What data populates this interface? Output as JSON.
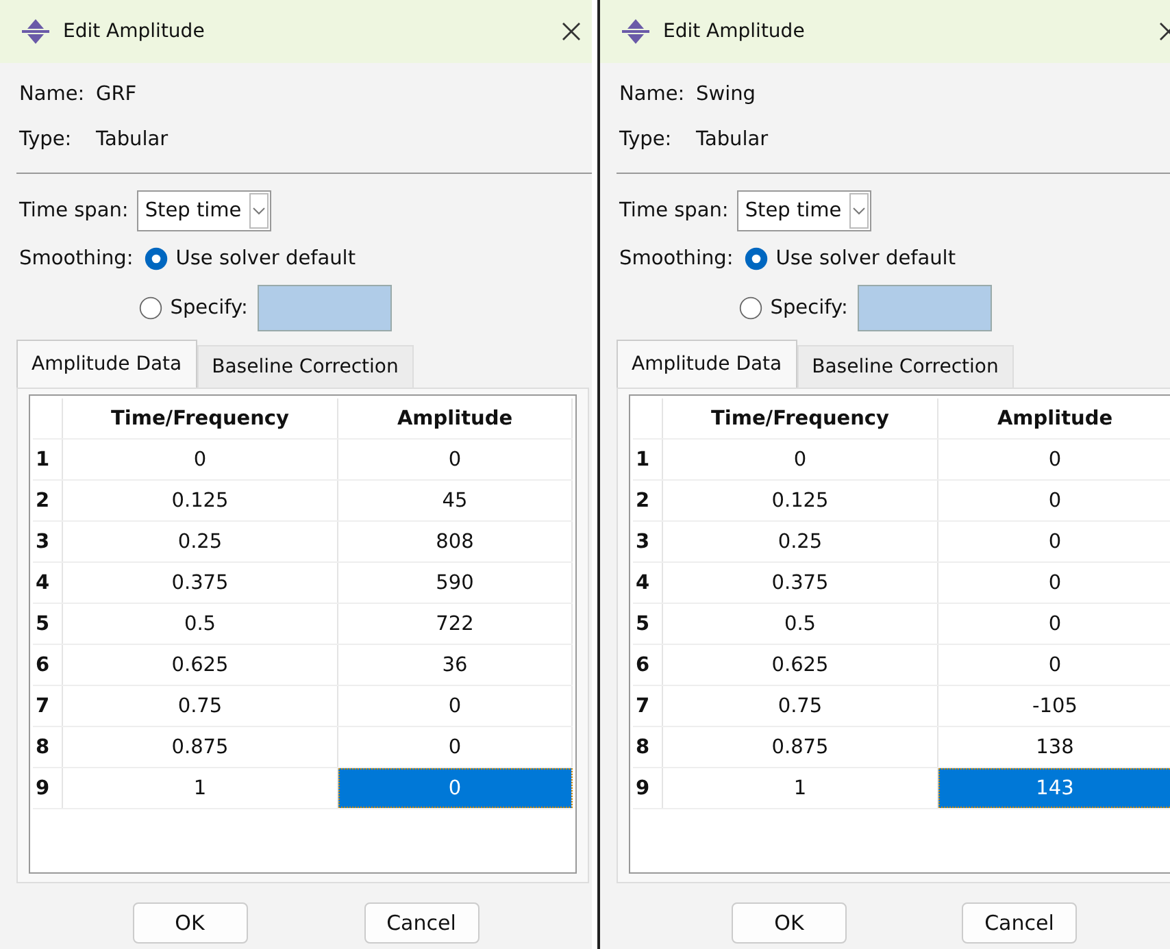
{
  "dialogs": [
    {
      "title": "Edit Amplitude",
      "name_label": "Name:",
      "name": "GRF",
      "type_label": "Type:",
      "type": "Tabular",
      "time_span_label": "Time span:",
      "time_span": "Step time",
      "smoothing_label": "Smoothing:",
      "smoothing_options": [
        {
          "label": "Use solver default",
          "selected": true,
          "kind": "radio"
        },
        {
          "label": "Specify:",
          "selected": false,
          "kind": "field"
        }
      ],
      "tabs": [
        {
          "label": "Amplitude Data",
          "selected": true
        },
        {
          "label": "Baseline Correction",
          "selected": false
        }
      ],
      "table": {
        "columns": [
          "Time/Frequency",
          "Amplitude"
        ],
        "rows": [
          {
            "index": "1",
            "cells": [
              {
                "text": "0",
                "selected": false
              },
              {
                "text": "0",
                "selected": false
              }
            ]
          },
          {
            "index": "2",
            "cells": [
              {
                "text": "0.125",
                "selected": false
              },
              {
                "text": "45",
                "selected": false
              }
            ]
          },
          {
            "index": "3",
            "cells": [
              {
                "text": "0.25",
                "selected": false
              },
              {
                "text": "808",
                "selected": false
              }
            ]
          },
          {
            "index": "4",
            "cells": [
              {
                "text": "0.375",
                "selected": false
              },
              {
                "text": "590",
                "selected": false
              }
            ]
          },
          {
            "index": "5",
            "cells": [
              {
                "text": "0.5",
                "selected": false
              },
              {
                "text": "722",
                "selected": false
              }
            ]
          },
          {
            "index": "6",
            "cells": [
              {
                "text": "0.625",
                "selected": false
              },
              {
                "text": "36",
                "selected": false
              }
            ]
          },
          {
            "index": "7",
            "cells": [
              {
                "text": "0.75",
                "selected": false
              },
              {
                "text": "0",
                "selected": false
              }
            ]
          },
          {
            "index": "8",
            "cells": [
              {
                "text": "0.875",
                "selected": false
              },
              {
                "text": "0",
                "selected": false
              }
            ]
          },
          {
            "index": "9",
            "cells": [
              {
                "text": "1",
                "selected": false
              },
              {
                "text": "0",
                "selected": true
              }
            ]
          }
        ]
      },
      "buttons": [
        "OK",
        "Cancel"
      ]
    },
    {
      "title": "Edit Amplitude",
      "name_label": "Name:",
      "name": "Swing",
      "type_label": "Type:",
      "type": "Tabular",
      "time_span_label": "Time span:",
      "time_span": "Step time",
      "smoothing_label": "Smoothing:",
      "smoothing_options": [
        {
          "label": "Use solver default",
          "selected": true,
          "kind": "radio"
        },
        {
          "label": "Specify:",
          "selected": false,
          "kind": "field"
        }
      ],
      "tabs": [
        {
          "label": "Amplitude Data",
          "selected": true
        },
        {
          "label": "Baseline Correction",
          "selected": false
        }
      ],
      "table": {
        "columns": [
          "Time/Frequency",
          "Amplitude"
        ],
        "rows": [
          {
            "index": "1",
            "cells": [
              {
                "text": "0",
                "selected": false
              },
              {
                "text": "0",
                "selected": false
              }
            ]
          },
          {
            "index": "2",
            "cells": [
              {
                "text": "0.125",
                "selected": false
              },
              {
                "text": "0",
                "selected": false
              }
            ]
          },
          {
            "index": "3",
            "cells": [
              {
                "text": "0.25",
                "selected": false
              },
              {
                "text": "0",
                "selected": false
              }
            ]
          },
          {
            "index": "4",
            "cells": [
              {
                "text": "0.375",
                "selected": false
              },
              {
                "text": "0",
                "selected": false
              }
            ]
          },
          {
            "index": "5",
            "cells": [
              {
                "text": "0.5",
                "selected": false
              },
              {
                "text": "0",
                "selected": false
              }
            ]
          },
          {
            "index": "6",
            "cells": [
              {
                "text": "0.625",
                "selected": false
              },
              {
                "text": "0",
                "selected": false
              }
            ]
          },
          {
            "index": "7",
            "cells": [
              {
                "text": "0.75",
                "selected": false
              },
              {
                "text": "-105",
                "selected": false
              }
            ]
          },
          {
            "index": "8",
            "cells": [
              {
                "text": "0.875",
                "selected": false
              },
              {
                "text": "138",
                "selected": false
              }
            ]
          },
          {
            "index": "9",
            "cells": [
              {
                "text": "1",
                "selected": false
              },
              {
                "text": "143",
                "selected": true
              }
            ]
          }
        ]
      },
      "buttons": [
        "OK",
        "Cancel"
      ]
    }
  ]
}
